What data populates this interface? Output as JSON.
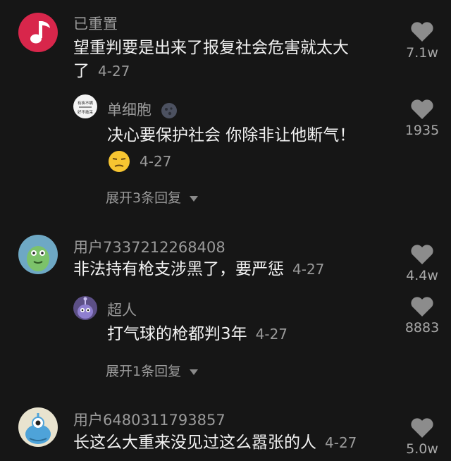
{
  "comments": [
    {
      "username": "已重置",
      "text_line1": "望重判要是出来了报复社会危害就太大",
      "text_line2": "了",
      "date": "4-27",
      "likes": "7.1w",
      "avatar_icon": "music-note-icon",
      "replies": [
        {
          "username": "单细胞",
          "badge_icon": "moon-face-icon",
          "text": "决心要保护社会 你除非让他断气！",
          "emoji_icon": "unamused-face-icon",
          "date": "4-27",
          "likes": "1935",
          "avatar_text_1": "有疾不瞒",
          "avatar_text_2": "好不敢呆"
        }
      ],
      "expand_label": "展开3条回复"
    },
    {
      "username": "用户7337212268408",
      "text": "非法持有枪支涉黑了，要严惩",
      "date": "4-27",
      "likes": "4.4w",
      "avatar_icon": "green-blob-icon",
      "replies": [
        {
          "username": "超人",
          "text": "打气球的枪都判3年",
          "date": "4-27",
          "likes": "8883",
          "avatar_icon": "purple-monster-icon"
        }
      ],
      "expand_label": "展开1条回复"
    },
    {
      "username": "用户6480311793857",
      "text": "长这么大重来没见过这么嚣张的人",
      "date": "4-27",
      "likes": "5.0w",
      "avatar_icon": "blue-alien-icon"
    }
  ],
  "colors": {
    "background": "#161616",
    "username": "#9a9a9a",
    "text": "#f2f2f2",
    "heart": "#8c8c8c"
  }
}
